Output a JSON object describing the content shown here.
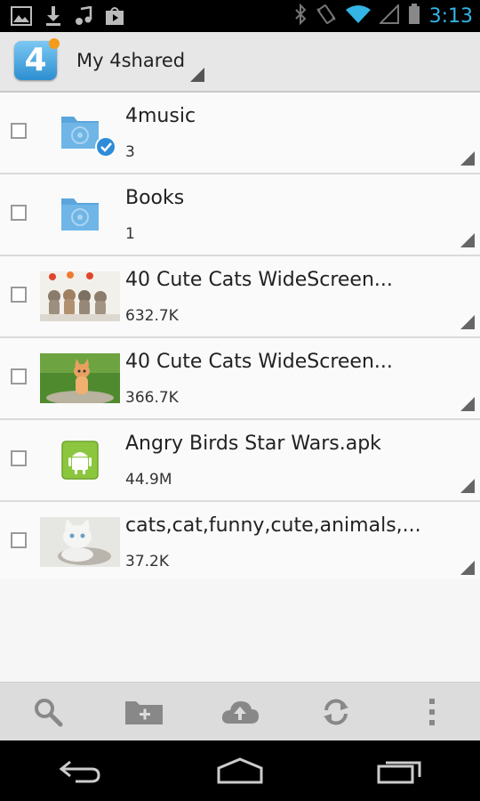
{
  "status_bar": {
    "time": "3:13",
    "icons": [
      "gallery-icon",
      "download-icon",
      "music-icon",
      "play-store-icon",
      "bluetooth-icon",
      "vibrate-icon",
      "wifi-icon",
      "signal-icon",
      "battery-icon"
    ],
    "time_color": "#33b5e5"
  },
  "app_bar": {
    "title": "My 4shared",
    "logo_glyph": "4"
  },
  "files": [
    {
      "name": "4music",
      "meta": "3",
      "type": "folder",
      "badge": "check"
    },
    {
      "name": "Books",
      "meta": "1",
      "type": "folder",
      "badge": ""
    },
    {
      "name": "40 Cute Cats WideScreen...",
      "meta": "632.7K",
      "type": "image",
      "thumb": "cats-row"
    },
    {
      "name": "40 Cute Cats WideScreen...",
      "meta": "366.7K",
      "type": "image",
      "thumb": "kitten-grass"
    },
    {
      "name": "Angry Birds Star Wars.apk",
      "meta": "44.9M",
      "type": "apk",
      "thumb": "android"
    },
    {
      "name": "cats,cat,funny,cute,animals,...",
      "meta": "37.2K",
      "type": "image",
      "thumb": "white-cats"
    }
  ],
  "actions": [
    "search-icon",
    "new-folder-icon",
    "upload-icon",
    "sync-icon",
    "overflow-menu-icon"
  ],
  "nav": [
    "back-icon",
    "home-icon",
    "recent-apps-icon"
  ],
  "colors": {
    "accent": "#33b5e5",
    "folder": "#5aa6dc",
    "android_green": "#8cc63f"
  }
}
